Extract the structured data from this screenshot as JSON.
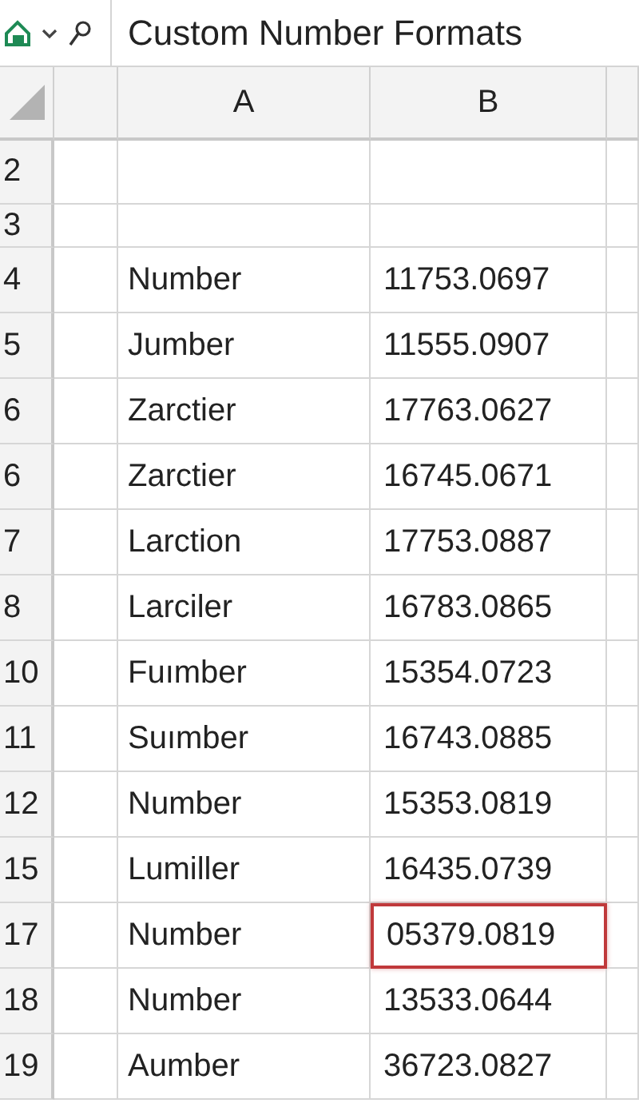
{
  "formula_bar": {
    "value": "Custom Number Formats"
  },
  "columns": [
    "A",
    "B"
  ],
  "rows": [
    {
      "number": "2",
      "a": "",
      "b": "",
      "selected": false,
      "kind": "tall"
    },
    {
      "number": "3",
      "a": "",
      "b": "",
      "selected": false,
      "kind": "short"
    },
    {
      "number": "4",
      "a": "Number",
      "b": "11753.0697",
      "selected": false,
      "kind": "data"
    },
    {
      "number": "5",
      "a": "Jumber",
      "b": "11555.0907",
      "selected": false,
      "kind": "data"
    },
    {
      "number": "6",
      "a": "Zarctier",
      "b": "17763.0627",
      "selected": false,
      "kind": "data"
    },
    {
      "number": "6",
      "a": "Zarctier",
      "b": "16745.0671",
      "selected": false,
      "kind": "data"
    },
    {
      "number": "7",
      "a": "Larction",
      "b": "17753.0887",
      "selected": false,
      "kind": "data"
    },
    {
      "number": "8",
      "a": "Larciler",
      "b": "16783.0865",
      "selected": false,
      "kind": "data"
    },
    {
      "number": "10",
      "a": "Fuımber",
      "b": "15354.0723",
      "selected": false,
      "kind": "data"
    },
    {
      "number": "11",
      "a": "Suımber",
      "b": "16743.0885",
      "selected": false,
      "kind": "data"
    },
    {
      "number": "12",
      "a": "Number",
      "b": "15353.0819",
      "selected": false,
      "kind": "data"
    },
    {
      "number": "15",
      "a": "Lumiller",
      "b": "16435.0739",
      "selected": false,
      "kind": "data"
    },
    {
      "number": "17",
      "a": "Number",
      "b": "05379.0819",
      "selected": true,
      "kind": "data"
    },
    {
      "number": "18",
      "a": "Number",
      "b": "13533.0644",
      "selected": false,
      "kind": "data"
    },
    {
      "number": "19",
      "a": "Aumber",
      "b": "36723.0827",
      "selected": false,
      "kind": "data"
    }
  ]
}
